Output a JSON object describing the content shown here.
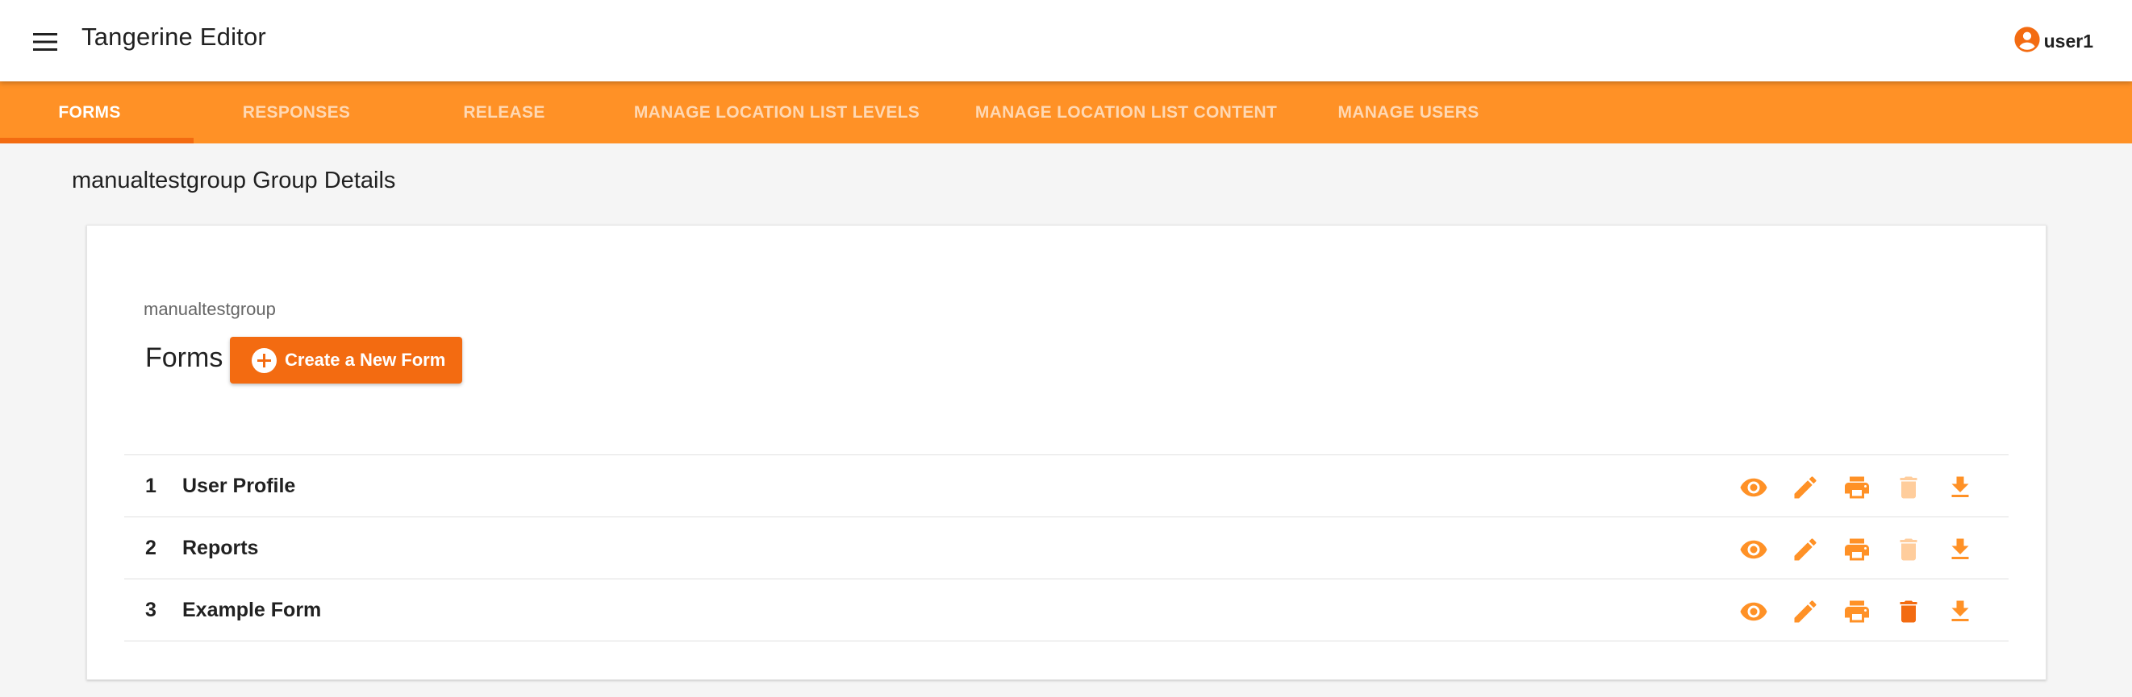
{
  "header": {
    "app_title": "Tangerine Editor",
    "username": "user1",
    "menu_icon": "menu-icon",
    "user_icon": "account-circle-icon"
  },
  "tabs": [
    {
      "label": "FORMS",
      "active": true
    },
    {
      "label": "RESPONSES",
      "active": false
    },
    {
      "label": "RELEASE",
      "active": false
    },
    {
      "label": "MANAGE LOCATION LIST LEVELS",
      "active": false
    },
    {
      "label": "MANAGE LOCATION LIST CONTENT",
      "active": false
    },
    {
      "label": "MANAGE USERS",
      "active": false
    }
  ],
  "page": {
    "title": "manualtestgroup Group Details",
    "group_name": "manualtestgroup",
    "forms_heading": "Forms",
    "create_button_label": "Create a New Form"
  },
  "forms": [
    {
      "number": "1",
      "title": "User Profile",
      "delete_enabled": false
    },
    {
      "number": "2",
      "title": "Reports",
      "delete_enabled": false
    },
    {
      "number": "3",
      "title": "Example Form",
      "delete_enabled": true
    }
  ],
  "row_action_icons": [
    "eye-icon",
    "pencil-icon",
    "print-icon",
    "trash-icon",
    "download-icon"
  ],
  "colors": {
    "accent": "#ff9126",
    "accent_dark": "#f36b11",
    "tab_inactive_text": "#ffd8b3",
    "background": "#f5f5f5"
  }
}
